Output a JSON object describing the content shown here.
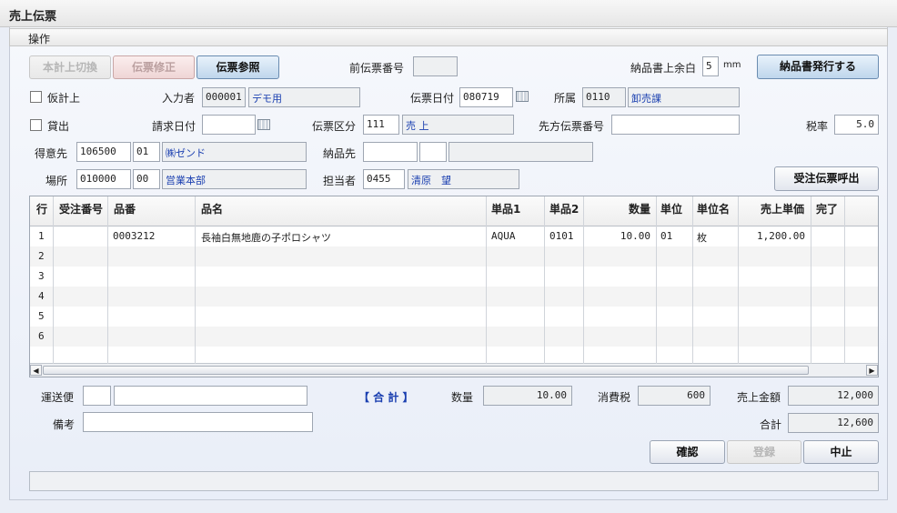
{
  "window": {
    "title": "売上伝票"
  },
  "menu": {
    "operations": "操作"
  },
  "toolbar": {
    "honkei_switch": "本計上切換",
    "slip_edit": "伝票修正",
    "slip_ref": "伝票参照",
    "issue_delivery": "納品書発行する",
    "call_order": "受注伝票呼出"
  },
  "header": {
    "prev_slip_label": "前伝票番号",
    "prev_slip_value": "",
    "margin_label": "納品書上余白",
    "margin_value": "5",
    "margin_unit": "mm",
    "provisional_label": "仮計上",
    "lending_label": "貸出",
    "entry_label": "入力者",
    "entry_code": "000001",
    "entry_name": "デモ用",
    "billing_date_label": "請求日付",
    "billing_date_value": "",
    "slip_date_label": "伝票日付",
    "slip_date_value": "080719",
    "belong_label": "所属",
    "belong_code": "0110",
    "belong_name": "卸売課",
    "slip_type_label": "伝票区分",
    "slip_type_code": "111",
    "slip_type_name": "売 上",
    "dest_slip_label": "先方伝票番号",
    "dest_slip_value": "",
    "tax_label": "税率",
    "tax_value": "5.0",
    "customer_label": "得意先",
    "customer_code": "106500",
    "customer_branch": "01",
    "customer_name": "㈱ゼンド",
    "delivery_label": "納品先",
    "location_label": "場所",
    "location_code": "010000",
    "location_branch": "00",
    "location_name": "営業本部",
    "staff_label": "担当者",
    "staff_code": "0455",
    "staff_name": "清原　望"
  },
  "grid": {
    "columns": [
      "行",
      "受注番号",
      "品番",
      "品名",
      "単品1",
      "単品2",
      "数量",
      "単位",
      "単位名",
      "売上単価",
      "完了"
    ],
    "rows": [
      {
        "row": "1",
        "order_no": "",
        "item_no": "0003212",
        "item_name": "長袖白無地鹿の子ポロシャツ",
        "tanpin1": "AQUA",
        "tanpin2": "0101",
        "qty": "10.00",
        "unit": "01",
        "unit_name": "枚",
        "price": "1,200.00",
        "done": ""
      },
      {
        "row": "2"
      },
      {
        "row": "3"
      },
      {
        "row": "4"
      },
      {
        "row": "5"
      },
      {
        "row": "6"
      }
    ]
  },
  "footer": {
    "shipping_label": "運送便",
    "notes_label": "備考",
    "total_title": "【 合 計 】",
    "qty_label": "数量",
    "qty_value": "10.00",
    "tax_label": "消費税",
    "tax_value": "600",
    "sales_label": "売上金額",
    "sales_value": "12,000",
    "sum_label": "合計",
    "sum_value": "12,600",
    "confirm": "確認",
    "register": "登録",
    "cancel": "中止"
  },
  "colors": {
    "accent": "#1a3fb0",
    "panel": "#eaeef6"
  }
}
